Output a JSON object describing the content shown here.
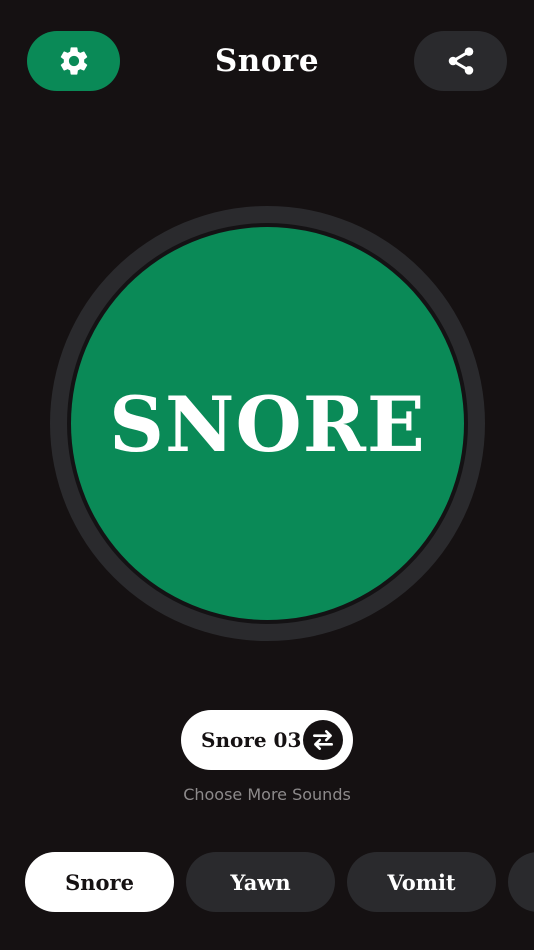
{
  "header": {
    "title": "Snore",
    "settings_icon": "gear-icon",
    "share_icon": "share-icon"
  },
  "main_button": {
    "label": "SNORE"
  },
  "sound_selector": {
    "value": "Snore 03",
    "icon": "swap-icon",
    "hint": "Choose More Sounds"
  },
  "tabs": [
    {
      "label": "Snore",
      "active": true
    },
    {
      "label": "Yawn",
      "active": false
    },
    {
      "label": "Vomit",
      "active": false
    }
  ],
  "colors": {
    "background": "#151112",
    "accent_green": "#0a8a57",
    "dark_surface": "#2a2a2d",
    "white": "#ffffff",
    "hint_gray": "#8d8a8b"
  }
}
